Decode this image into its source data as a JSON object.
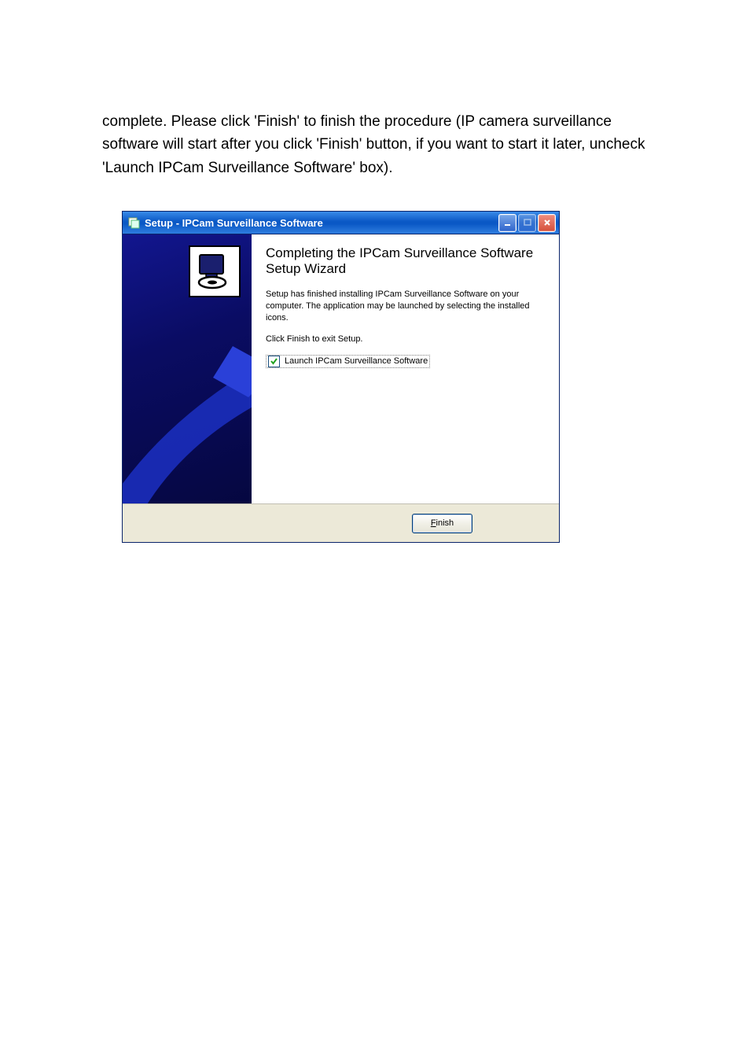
{
  "doc": {
    "paragraph": "complete. Please click 'Finish' to finish the procedure (IP camera surveillance software will start after you click 'Finish' button, if you want to start it later, uncheck 'Launch IPCam Surveillance Software' box)."
  },
  "window": {
    "title": "Setup - IPCam Surveillance Software",
    "heading": "Completing the IPCam Surveillance Software Setup Wizard",
    "body1": "Setup has finished installing IPCam Surveillance Software on your computer. The application may be launched by selecting the installed icons.",
    "body2": "Click Finish to exit Setup.",
    "checkbox_label": "Launch IPCam Surveillance Software",
    "checkbox_checked": true,
    "finish_label": "Finish"
  },
  "icons": {
    "setup": "setup-icon",
    "minimize": "minimize-icon",
    "maximize": "maximize-icon",
    "close": "close-icon",
    "check": "check-icon",
    "monitor": "monitor-disc-icon"
  }
}
